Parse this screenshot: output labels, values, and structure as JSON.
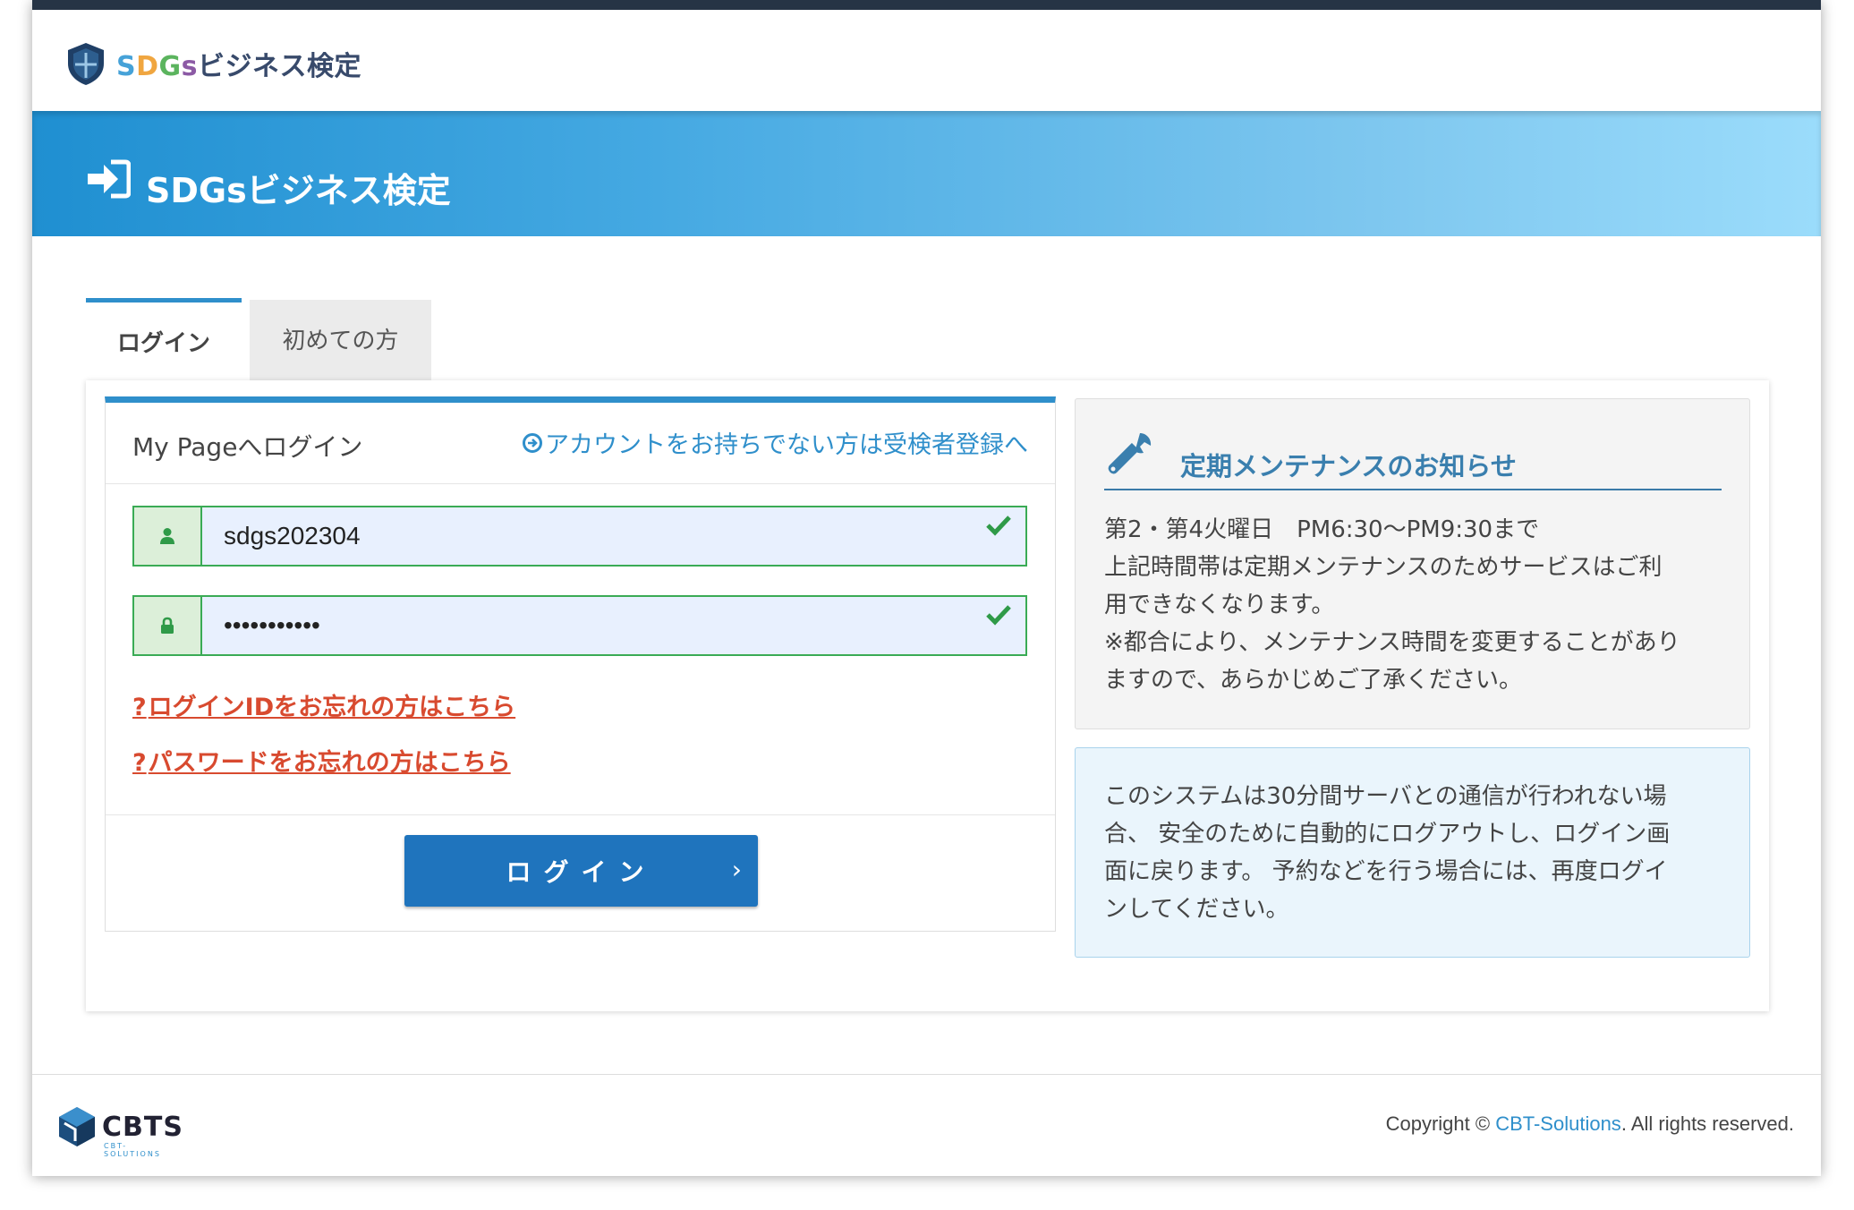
{
  "header": {
    "logo_text_latin": "SDGs",
    "logo_text_jp": "ビジネス検定"
  },
  "banner": {
    "title": "SDGsビジネス検定"
  },
  "tabs": [
    {
      "label": "ログイン"
    },
    {
      "label": "初めての方"
    }
  ],
  "login": {
    "title": "My Pageへログイン",
    "register_link": "アカウントをお持ちでない方は受検者登録へ",
    "username_value": "sdgs202304",
    "password_value": "sdgs202304a",
    "forgot_id": "ログインIDをお忘れの方はこちら",
    "forgot_password": "パスワードをお忘れの方はこちら",
    "forgot_prefix": "?",
    "button_label": "ログイン",
    "button_chevron": "›"
  },
  "maintenance": {
    "title": "定期メンテナンスのお知らせ",
    "lines": [
      "第2・第4火曜日　PM6:30〜PM9:30まで",
      "上記時間帯は定期メンテナンスのためサービスはご利",
      "用できなくなります。",
      "※都合により、メンテナンス時間を変更することがあり",
      "ますので、あらかじめご了承ください。"
    ]
  },
  "info": {
    "lines": [
      "このシステムは30分間サーバとの通信が行われない場",
      "合、 安全のために自動的にログアウトし、ログイン画",
      "面に戻ります。 予約などを行う場合には、再度ログイ",
      "ンしてください。"
    ]
  },
  "footer": {
    "logo_text": "CBTS",
    "logo_sub": "CBT-SOLUTIONS",
    "copyright_prefix": "Copyright © ",
    "copyright_link": "CBT-Solutions",
    "copyright_suffix": ". All rights reserved."
  },
  "colors": {
    "accent": "#2f8fcb",
    "button": "#1f74bd",
    "error_link": "#d84a2f",
    "valid": "#3aab55"
  }
}
